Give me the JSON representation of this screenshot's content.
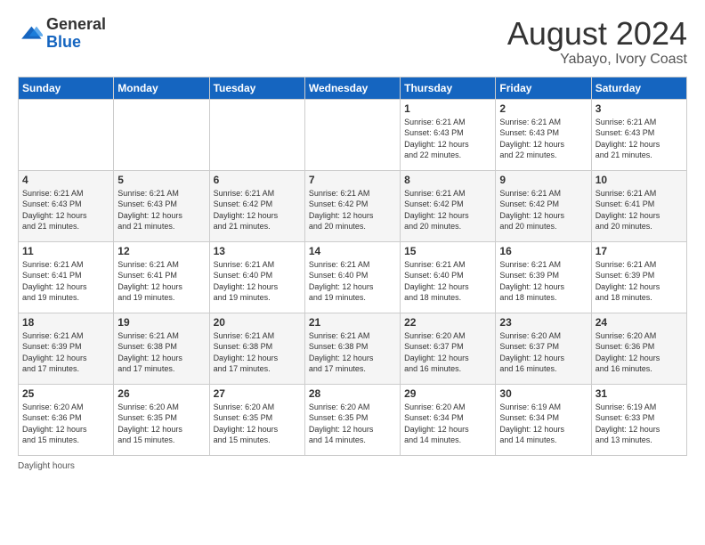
{
  "header": {
    "logo_general": "General",
    "logo_blue": "Blue",
    "title": "August 2024",
    "location": "Yabayo, Ivory Coast"
  },
  "days_of_week": [
    "Sunday",
    "Monday",
    "Tuesday",
    "Wednesday",
    "Thursday",
    "Friday",
    "Saturday"
  ],
  "weeks": [
    [
      {
        "day": "",
        "info": ""
      },
      {
        "day": "",
        "info": ""
      },
      {
        "day": "",
        "info": ""
      },
      {
        "day": "",
        "info": ""
      },
      {
        "day": "1",
        "info": "Sunrise: 6:21 AM\nSunset: 6:43 PM\nDaylight: 12 hours\nand 22 minutes."
      },
      {
        "day": "2",
        "info": "Sunrise: 6:21 AM\nSunset: 6:43 PM\nDaylight: 12 hours\nand 22 minutes."
      },
      {
        "day": "3",
        "info": "Sunrise: 6:21 AM\nSunset: 6:43 PM\nDaylight: 12 hours\nand 21 minutes."
      }
    ],
    [
      {
        "day": "4",
        "info": "Sunrise: 6:21 AM\nSunset: 6:43 PM\nDaylight: 12 hours\nand 21 minutes."
      },
      {
        "day": "5",
        "info": "Sunrise: 6:21 AM\nSunset: 6:43 PM\nDaylight: 12 hours\nand 21 minutes."
      },
      {
        "day": "6",
        "info": "Sunrise: 6:21 AM\nSunset: 6:42 PM\nDaylight: 12 hours\nand 21 minutes."
      },
      {
        "day": "7",
        "info": "Sunrise: 6:21 AM\nSunset: 6:42 PM\nDaylight: 12 hours\nand 20 minutes."
      },
      {
        "day": "8",
        "info": "Sunrise: 6:21 AM\nSunset: 6:42 PM\nDaylight: 12 hours\nand 20 minutes."
      },
      {
        "day": "9",
        "info": "Sunrise: 6:21 AM\nSunset: 6:42 PM\nDaylight: 12 hours\nand 20 minutes."
      },
      {
        "day": "10",
        "info": "Sunrise: 6:21 AM\nSunset: 6:41 PM\nDaylight: 12 hours\nand 20 minutes."
      }
    ],
    [
      {
        "day": "11",
        "info": "Sunrise: 6:21 AM\nSunset: 6:41 PM\nDaylight: 12 hours\nand 19 minutes."
      },
      {
        "day": "12",
        "info": "Sunrise: 6:21 AM\nSunset: 6:41 PM\nDaylight: 12 hours\nand 19 minutes."
      },
      {
        "day": "13",
        "info": "Sunrise: 6:21 AM\nSunset: 6:40 PM\nDaylight: 12 hours\nand 19 minutes."
      },
      {
        "day": "14",
        "info": "Sunrise: 6:21 AM\nSunset: 6:40 PM\nDaylight: 12 hours\nand 19 minutes."
      },
      {
        "day": "15",
        "info": "Sunrise: 6:21 AM\nSunset: 6:40 PM\nDaylight: 12 hours\nand 18 minutes."
      },
      {
        "day": "16",
        "info": "Sunrise: 6:21 AM\nSunset: 6:39 PM\nDaylight: 12 hours\nand 18 minutes."
      },
      {
        "day": "17",
        "info": "Sunrise: 6:21 AM\nSunset: 6:39 PM\nDaylight: 12 hours\nand 18 minutes."
      }
    ],
    [
      {
        "day": "18",
        "info": "Sunrise: 6:21 AM\nSunset: 6:39 PM\nDaylight: 12 hours\nand 17 minutes."
      },
      {
        "day": "19",
        "info": "Sunrise: 6:21 AM\nSunset: 6:38 PM\nDaylight: 12 hours\nand 17 minutes."
      },
      {
        "day": "20",
        "info": "Sunrise: 6:21 AM\nSunset: 6:38 PM\nDaylight: 12 hours\nand 17 minutes."
      },
      {
        "day": "21",
        "info": "Sunrise: 6:21 AM\nSunset: 6:38 PM\nDaylight: 12 hours\nand 17 minutes."
      },
      {
        "day": "22",
        "info": "Sunrise: 6:20 AM\nSunset: 6:37 PM\nDaylight: 12 hours\nand 16 minutes."
      },
      {
        "day": "23",
        "info": "Sunrise: 6:20 AM\nSunset: 6:37 PM\nDaylight: 12 hours\nand 16 minutes."
      },
      {
        "day": "24",
        "info": "Sunrise: 6:20 AM\nSunset: 6:36 PM\nDaylight: 12 hours\nand 16 minutes."
      }
    ],
    [
      {
        "day": "25",
        "info": "Sunrise: 6:20 AM\nSunset: 6:36 PM\nDaylight: 12 hours\nand 15 minutes."
      },
      {
        "day": "26",
        "info": "Sunrise: 6:20 AM\nSunset: 6:35 PM\nDaylight: 12 hours\nand 15 minutes."
      },
      {
        "day": "27",
        "info": "Sunrise: 6:20 AM\nSunset: 6:35 PM\nDaylight: 12 hours\nand 15 minutes."
      },
      {
        "day": "28",
        "info": "Sunrise: 6:20 AM\nSunset: 6:35 PM\nDaylight: 12 hours\nand 14 minutes."
      },
      {
        "day": "29",
        "info": "Sunrise: 6:20 AM\nSunset: 6:34 PM\nDaylight: 12 hours\nand 14 minutes."
      },
      {
        "day": "30",
        "info": "Sunrise: 6:19 AM\nSunset: 6:34 PM\nDaylight: 12 hours\nand 14 minutes."
      },
      {
        "day": "31",
        "info": "Sunrise: 6:19 AM\nSunset: 6:33 PM\nDaylight: 12 hours\nand 13 minutes."
      }
    ]
  ],
  "footer": {
    "daylight_label": "Daylight hours"
  }
}
